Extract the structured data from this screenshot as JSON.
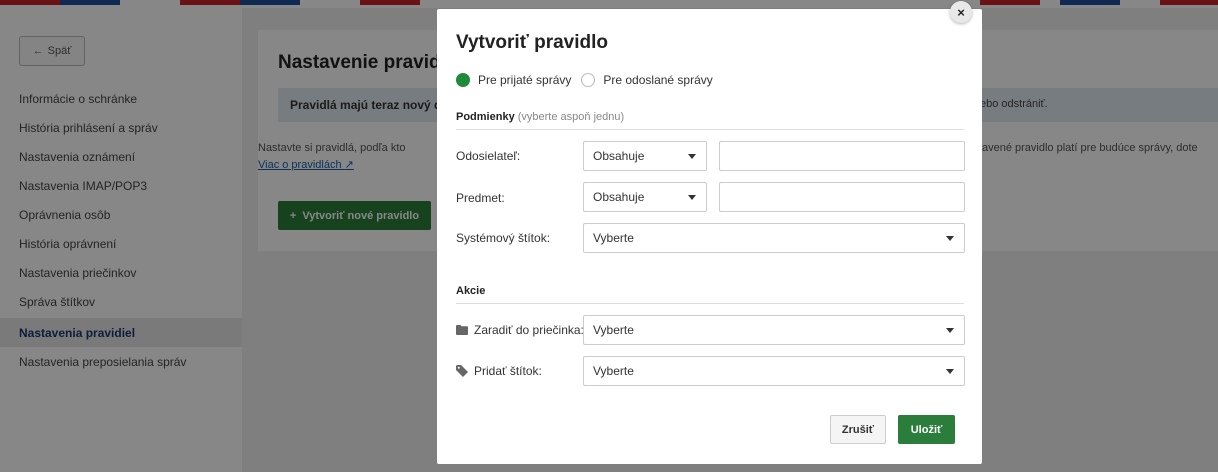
{
  "colors": {
    "accent_green": "#2a7d3a",
    "radio_green": "#1f8a3a",
    "nav_active_text": "#1c3a6e",
    "info_bar_bg": "#e1ebf4",
    "link_blue": "#1a5faa",
    "stripe_red": "#c8202a",
    "stripe_blue": "#1e4f9c"
  },
  "sidebar": {
    "back_label": "Späť",
    "items": [
      {
        "label": "Informácie o schránke",
        "active": false
      },
      {
        "label": "História prihlásení a správ",
        "active": false
      },
      {
        "label": "Nastavenia oznámení",
        "active": false
      },
      {
        "label": "Nastavenia IMAP/POP3",
        "active": false
      },
      {
        "label": "Oprávnenia osôb",
        "active": false
      },
      {
        "label": "História oprávnení",
        "active": false
      },
      {
        "label": "Nastavenia priečinkov",
        "active": false
      },
      {
        "label": "Správa štítkov",
        "active": false
      },
      {
        "label": "Nastavenia pravidiel",
        "active": true
      },
      {
        "label": "Nastavenia preposielania správ",
        "active": false
      }
    ]
  },
  "main": {
    "title": "Nastavenie pravid",
    "info_text": "Pravidlá majú teraz nový d",
    "info_text_tail": "ebo odstrániť.",
    "description": "Nastavte si pravidlá, podľa kto",
    "description_tail": "avené pravidlo platí pre budúce správy, dote",
    "more_link": "Viac o pravidlách",
    "create_button": "Vytvoriť nové pravidlo"
  },
  "modal": {
    "title": "Vytvoriť pravidlo",
    "close_glyph": "×",
    "radio_options": [
      {
        "label": "Pre prijaté správy",
        "checked": true
      },
      {
        "label": "Pre odoslané správy",
        "checked": false
      }
    ],
    "conditions_heading": "Podmienky",
    "conditions_hint": "(vyberte aspoň jednu)",
    "conditions": {
      "sender": {
        "label": "Odosielateľ:",
        "operator": "Obsahuje",
        "value": ""
      },
      "subject": {
        "label": "Predmet:",
        "operator": "Obsahuje",
        "value": ""
      },
      "system_label": {
        "label": "Systémový štítok:",
        "value": "Vyberte"
      }
    },
    "actions_heading": "Akcie",
    "actions": {
      "move_to_folder": {
        "label": "Zaradiť do priečinka:",
        "icon": "folder-icon",
        "value": "Vyberte"
      },
      "add_label": {
        "label": "Pridať štítok:",
        "icon": "tag-icon",
        "value": "Vyberte"
      }
    },
    "cancel_label": "Zrušiť",
    "save_label": "Uložiť"
  }
}
